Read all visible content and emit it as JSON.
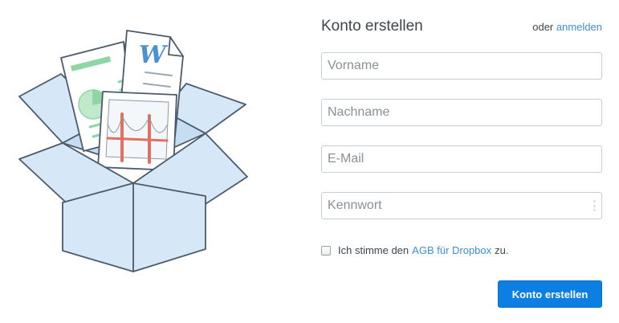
{
  "form": {
    "title": "Konto erstellen",
    "login_prefix": "oder",
    "login_link": "anmelden",
    "first_name_placeholder": "Vorname",
    "last_name_placeholder": "Nachname",
    "email_placeholder": "E-Mail",
    "password_placeholder": "Kennwort",
    "terms_prefix": "Ich stimme den",
    "terms_link": "AGB für Dropbox",
    "terms_suffix": "zu.",
    "terms_checked": false,
    "submit_label": "Konto erstellen"
  },
  "illustration": {
    "doc_letter": "W",
    "colors": {
      "box_fill": "#d6e7f7",
      "box_stroke": "#4b5b6b",
      "accent_green": "#8ed6a3",
      "bridge_red": "#e07060"
    }
  }
}
